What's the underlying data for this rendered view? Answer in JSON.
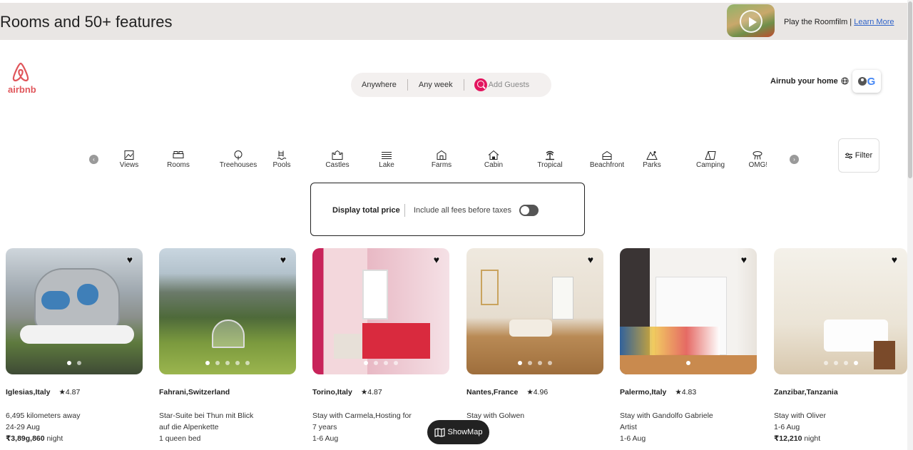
{
  "banner": {
    "title": "Rooms and 50+ features",
    "promo_text": "Play the Roomfilm |",
    "promo_link": "Learn More"
  },
  "logo": {
    "text": "airbnb"
  },
  "search": {
    "anywhere": "Anywhere",
    "any_week": "Any week",
    "add_guests": "Add Guests"
  },
  "header": {
    "host_link": "Airnub your home",
    "globe_icon": "globe-icon"
  },
  "categories": [
    {
      "label": "Views",
      "icon": "views-icon"
    },
    {
      "label": "Rooms",
      "icon": "rooms-icon"
    },
    {
      "label": "Treehouses",
      "icon": "treehouse-icon"
    },
    {
      "label": "Pools",
      "icon": "pool-icon"
    },
    {
      "label": "Castles",
      "icon": "castle-icon"
    },
    {
      "label": "Lake",
      "icon": "lake-icon"
    },
    {
      "label": "Farms",
      "icon": "farm-icon"
    },
    {
      "label": "Cabin",
      "icon": "cabin-icon"
    },
    {
      "label": "Tropical",
      "icon": "tropical-icon"
    },
    {
      "label": "Beachfront",
      "icon": "beachfront-icon"
    },
    {
      "label": "Parks",
      "icon": "parks-icon"
    },
    {
      "label": "Camping",
      "icon": "camping-icon"
    },
    {
      "label": "OMG!",
      "icon": "omg-icon"
    }
  ],
  "filter": {
    "label": "Filter"
  },
  "total_price": {
    "title": "Display total price",
    "subtitle": "Include all fees before taxes",
    "enabled": false
  },
  "listings": [
    {
      "location": "Iglesias,Italy",
      "rating": "★4.87",
      "line1": "6,495 kilometers away",
      "line2": "24-29 Aug",
      "line3": "",
      "price": "₹3,89g,860",
      "price_unit": "night"
    },
    {
      "location": "Fahrani,Switzerland",
      "rating": "",
      "line1": "Star-Suite bei Thun mit Blick",
      "line2": "auf die Alpenkette",
      "line3": "1 queen bed",
      "price": "",
      "price_unit": ""
    },
    {
      "location": "Torino,Italy",
      "rating": "★4.87",
      "line1": "Stay with Carmela,Hosting for",
      "line2": "7 years",
      "line3": "1-6 Aug",
      "price": "",
      "price_unit": ""
    },
    {
      "location": "Nantes,France",
      "rating": "★4.96",
      "line1": "Stay with Golwen",
      "line2": "",
      "line3": "",
      "price": "",
      "price_unit": ""
    },
    {
      "location": "Palermo,Italy",
      "rating": "★4.83",
      "line1": "Stay with Gandolfo Gabriele",
      "line2": "Artist",
      "line3": "1-6 Aug",
      "price": "",
      "price_unit": ""
    },
    {
      "location": "Zanzibar,Tanzania",
      "rating": "",
      "line1": "Stay with Oliver",
      "line2": "1-6 Aug",
      "line3": "",
      "price": "₹12,210",
      "price_unit": "night"
    }
  ],
  "show_map": {
    "label": "ShowMap"
  },
  "colors": {
    "brand": "#e0565b",
    "search_accent": "#e3155f"
  }
}
